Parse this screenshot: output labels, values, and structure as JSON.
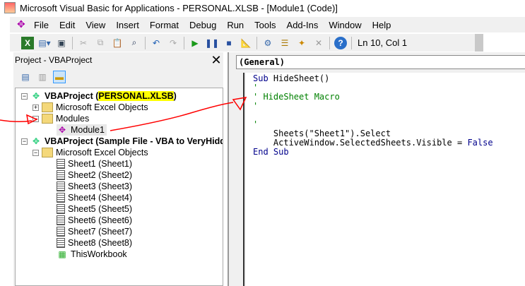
{
  "window": {
    "title": "Microsoft Visual Basic for Applications - PERSONAL.XLSB - [Module1 (Code)]"
  },
  "menu": [
    "File",
    "Edit",
    "View",
    "Insert",
    "Format",
    "Debug",
    "Run",
    "Tools",
    "Add-Ins",
    "Window",
    "Help"
  ],
  "toolbar": {
    "position": "Ln 10, Col 1"
  },
  "project_panel": {
    "title": "Project - VBAProject",
    "close": "✕"
  },
  "tree": {
    "p1": {
      "label": "VBAProject (",
      "name": "PERSONAL.XLSB",
      "close": ")"
    },
    "p1_objects": "Microsoft Excel Objects",
    "p1_modules": "Modules",
    "p1_module1": "Module1",
    "p2": "VBAProject (Sample File - VBA to VeryHidden)",
    "p2_objects": "Microsoft Excel Objects",
    "sheets": [
      "Sheet1 (Sheet1)",
      "Sheet2 (Sheet2)",
      "Sheet3 (Sheet3)",
      "Sheet4 (Sheet4)",
      "Sheet5 (Sheet5)",
      "Sheet6 (Sheet6)",
      "Sheet7 (Sheet7)",
      "Sheet8 (Sheet8)",
      "ThisWorkbook"
    ]
  },
  "code": {
    "object_combo": "(General)",
    "lines": [
      [
        {
          "t": "Sub",
          "c": "kw"
        },
        {
          "t": " HideSheet()",
          "c": ""
        }
      ],
      [
        {
          "t": "'",
          "c": "cm"
        }
      ],
      [
        {
          "t": "' HideSheet Macro",
          "c": "cm"
        }
      ],
      [
        {
          "t": "'",
          "c": "cm"
        }
      ],
      [],
      [
        {
          "t": "'",
          "c": "cm"
        }
      ],
      [
        {
          "t": "    Sheets(\"Sheet1\").Select",
          "c": ""
        }
      ],
      [
        {
          "t": "    ActiveWindow.SelectedSheets.Visible = ",
          "c": ""
        },
        {
          "t": "False",
          "c": "kw"
        }
      ],
      [
        {
          "t": "End Sub",
          "c": "kw"
        }
      ]
    ]
  },
  "colors": {
    "keyword": "#00008b",
    "comment": "#008000",
    "highlight": "#ffff00",
    "annotation": "#ff0000"
  }
}
